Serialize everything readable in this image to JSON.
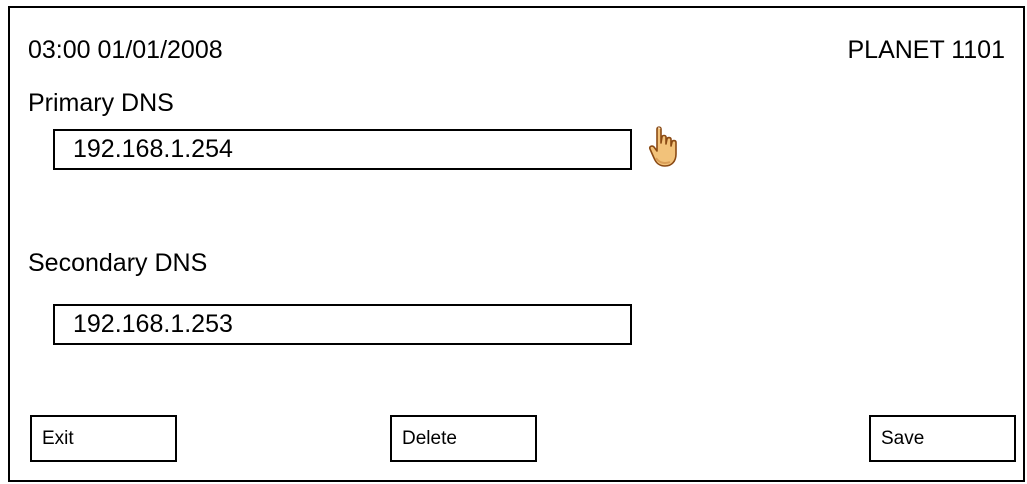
{
  "header": {
    "datetime": "03:00 01/01/2008",
    "device_name": "PLANET 1101"
  },
  "primary_dns": {
    "label": "Primary DNS",
    "value": "192.168.1.254"
  },
  "secondary_dns": {
    "label": "Secondary DNS",
    "value": "192.168.1.253"
  },
  "pointer": {
    "icon": "hand-pointer-icon",
    "focus": "primary_dns"
  },
  "buttons": {
    "exit": "Exit",
    "delete": "Delete",
    "save": "Save"
  }
}
